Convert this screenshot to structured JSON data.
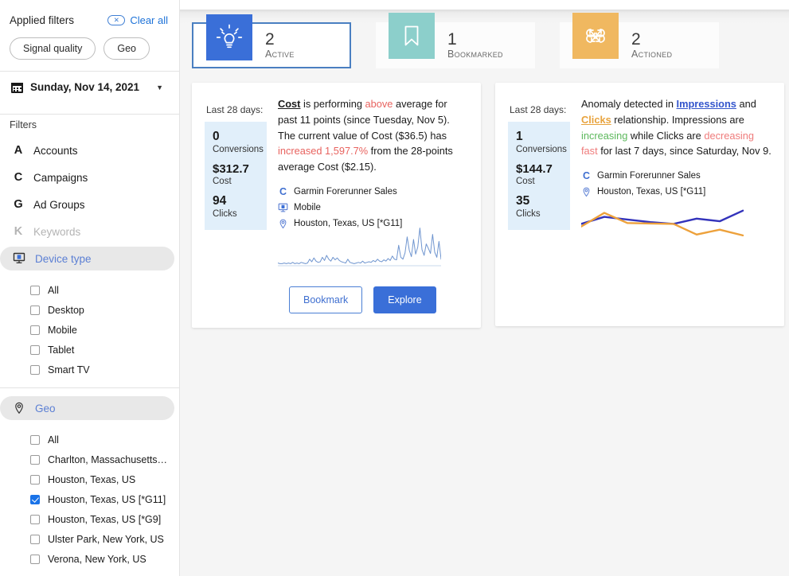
{
  "sidebar": {
    "applied_filters_title": "Applied filters",
    "clear_all_label": "Clear all",
    "clear_all_icon": "oval-x-icon",
    "chips": [
      {
        "label": "Signal quality"
      },
      {
        "label": "Geo"
      }
    ],
    "date_picker": {
      "icon": "calendar-icon",
      "value": "Sunday, Nov 14, 2021",
      "caret_icon": "chevron-down-icon"
    },
    "filters_label": "Filters",
    "filter_items": [
      {
        "letter": "A",
        "label": "Accounts",
        "state": "normal",
        "icon": "letter-a-icon"
      },
      {
        "letter": "C",
        "label": "Campaigns",
        "state": "normal",
        "icon": "letter-c-icon"
      },
      {
        "letter": "G",
        "label": "Ad Groups",
        "state": "normal",
        "icon": "letter-g-icon"
      },
      {
        "letter": "K",
        "label": "Keywords",
        "state": "disabled",
        "icon": "letter-k-icon"
      }
    ],
    "device_type": {
      "label": "Device type",
      "icon": "monitor-device-icon",
      "options": [
        {
          "label": "All",
          "checked": false
        },
        {
          "label": "Desktop",
          "checked": false
        },
        {
          "label": "Mobile",
          "checked": false
        },
        {
          "label": "Tablet",
          "checked": false
        },
        {
          "label": "Smart TV",
          "checked": false
        }
      ]
    },
    "geo": {
      "label": "Geo",
      "icon": "map-pin-icon",
      "options": [
        {
          "label": "All",
          "checked": false
        },
        {
          "label": "Charlton, Massachusetts…",
          "checked": false
        },
        {
          "label": "Houston, Texas, US",
          "checked": false
        },
        {
          "label": "Houston, Texas, US [*G11]",
          "checked": true
        },
        {
          "label": "Houston, Texas, US [*G9]",
          "checked": false
        },
        {
          "label": "Ulster Park, New York, US",
          "checked": false
        },
        {
          "label": "Verona, New York, US",
          "checked": false
        }
      ]
    }
  },
  "stats": [
    {
      "count": "2",
      "label": "Active",
      "icon": "lightbulb-icon",
      "icon_color": "#3a6fd8",
      "selected": true
    },
    {
      "count": "1",
      "label": "Bookmarked",
      "icon": "bookmark-icon",
      "icon_color": "#8ccfcb",
      "selected": false
    },
    {
      "count": "2",
      "label": "Actioned",
      "icon": "knot-arrows-icon",
      "icon_color": "#f0b860",
      "selected": false
    }
  ],
  "cards": [
    {
      "last28_label": "Last 28 days:",
      "metrics": [
        {
          "value": "0",
          "caption": "Conversions"
        },
        {
          "value": "$312.7",
          "caption": "Cost"
        },
        {
          "value": "94",
          "caption": "Clicks"
        }
      ],
      "text_parts": [
        {
          "text": "Cost",
          "style": "bold-underline"
        },
        {
          "text": " is performing ",
          "style": "plain"
        },
        {
          "text": "above",
          "style": "red"
        },
        {
          "text": " average for past 11 points (since Tuesday, Nov 5). The current value of Cost ($36.5) has ",
          "style": "plain"
        },
        {
          "text": "increased 1,597.7%",
          "style": "red"
        },
        {
          "text": " from the 28-points average Cost ($2.15).",
          "style": "plain"
        }
      ],
      "meta": [
        {
          "icon": "letter-c-icon",
          "glyph": "C",
          "label": "Garmin Forerunner Sales"
        },
        {
          "icon": "monitor-device-icon",
          "glyph": "",
          "label": "Mobile"
        },
        {
          "icon": "map-pin-icon",
          "glyph": "",
          "label": "Houston, Texas, US [*G11]"
        }
      ],
      "buttons": [
        {
          "label": "Bookmark",
          "kind": "ghost"
        },
        {
          "label": "Explore",
          "kind": "primary"
        }
      ]
    },
    {
      "last28_label": "Last 28 days:",
      "metrics": [
        {
          "value": "1",
          "caption": "Conversions"
        },
        {
          "value": "$144.7",
          "caption": "Cost"
        },
        {
          "value": "35",
          "caption": "Clicks"
        }
      ],
      "text_parts": [
        {
          "text": "Anomaly detected in ",
          "style": "plain"
        },
        {
          "text": "Impressions",
          "style": "link-blue"
        },
        {
          "text": " and ",
          "style": "plain"
        },
        {
          "text": "Clicks",
          "style": "link-orange"
        },
        {
          "text": " relationship. Impressions are ",
          "style": "plain"
        },
        {
          "text": "increasing",
          "style": "green"
        },
        {
          "text": " while Clicks are ",
          "style": "plain"
        },
        {
          "text": "decreasing fast",
          "style": "pink"
        },
        {
          "text": " for last 7 days, since Saturday, Nov 9.",
          "style": "plain"
        }
      ],
      "meta": [
        {
          "icon": "letter-c-icon",
          "glyph": "C",
          "label": "Garmin Forerunner Sales"
        },
        {
          "icon": "map-pin-icon",
          "glyph": "",
          "label": "Houston, Texas, US [*G11]"
        }
      ],
      "buttons": []
    }
  ],
  "chart_data": [
    {
      "type": "line",
      "name": "cost-sparkline",
      "title": "",
      "series": [
        {
          "name": "Cost",
          "color": "#6f95cf",
          "values": [
            3,
            2,
            2,
            3,
            2,
            3,
            2,
            4,
            2,
            3,
            2,
            4,
            3,
            2,
            3,
            9,
            5,
            11,
            6,
            4,
            5,
            12,
            7,
            15,
            9,
            6,
            12,
            8,
            11,
            7,
            5,
            4,
            3,
            9,
            4,
            3,
            2,
            3,
            4,
            3,
            6,
            3,
            4,
            5,
            4,
            7,
            5,
            9,
            6,
            5,
            8,
            6,
            10,
            7,
            14,
            9,
            8,
            31,
            12,
            9,
            19,
            44,
            23,
            13,
            40,
            17,
            28,
            58,
            24,
            15,
            33,
            26,
            18,
            48,
            20,
            12,
            37,
            9
          ]
        }
      ],
      "ylim": [
        0,
        60
      ],
      "grid": false,
      "legend": "none"
    },
    {
      "type": "line",
      "name": "impressions-clicks-anomaly",
      "title": "",
      "x": [
        1,
        2,
        3,
        4,
        5,
        6,
        7,
        8
      ],
      "series": [
        {
          "name": "Impressions",
          "color": "#3333bb",
          "values": [
            46,
            62,
            56,
            50,
            46,
            58,
            52,
            76
          ]
        },
        {
          "name": "Clicks",
          "color": "#eda13b",
          "values": [
            40,
            71,
            48,
            47,
            46,
            22,
            33,
            20
          ]
        }
      ],
      "ylim": [
        0,
        90
      ],
      "grid": false,
      "legend": "none"
    }
  ]
}
